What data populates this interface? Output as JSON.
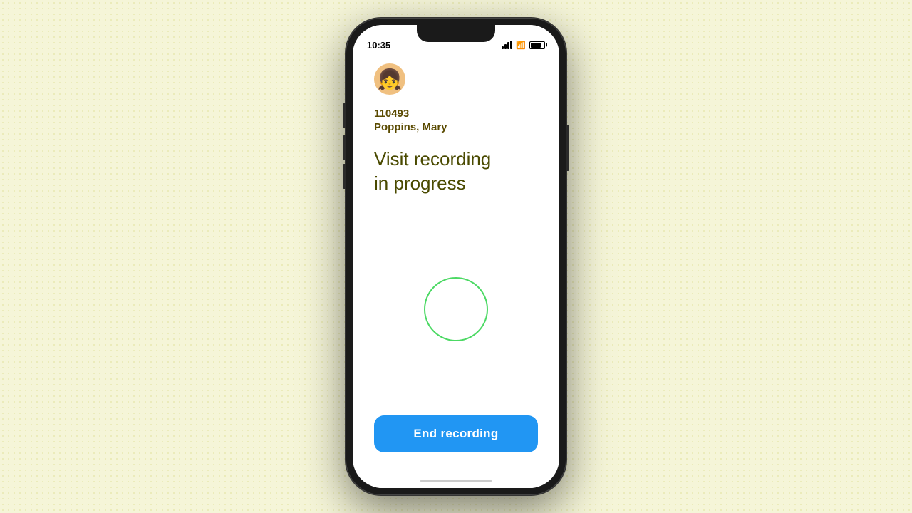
{
  "background": {
    "color": "#f5f5d8"
  },
  "phone": {
    "status_bar": {
      "time": "10:35",
      "signal_label": "signal",
      "wifi_label": "wifi",
      "battery_label": "battery"
    },
    "app": {
      "avatar_emoji": "👩",
      "patient_id": "110493",
      "patient_name": "Poppins, Mary",
      "recording_title_line1": "Visit recording",
      "recording_title_line2": "in progress",
      "end_recording_button": "End recording"
    }
  }
}
